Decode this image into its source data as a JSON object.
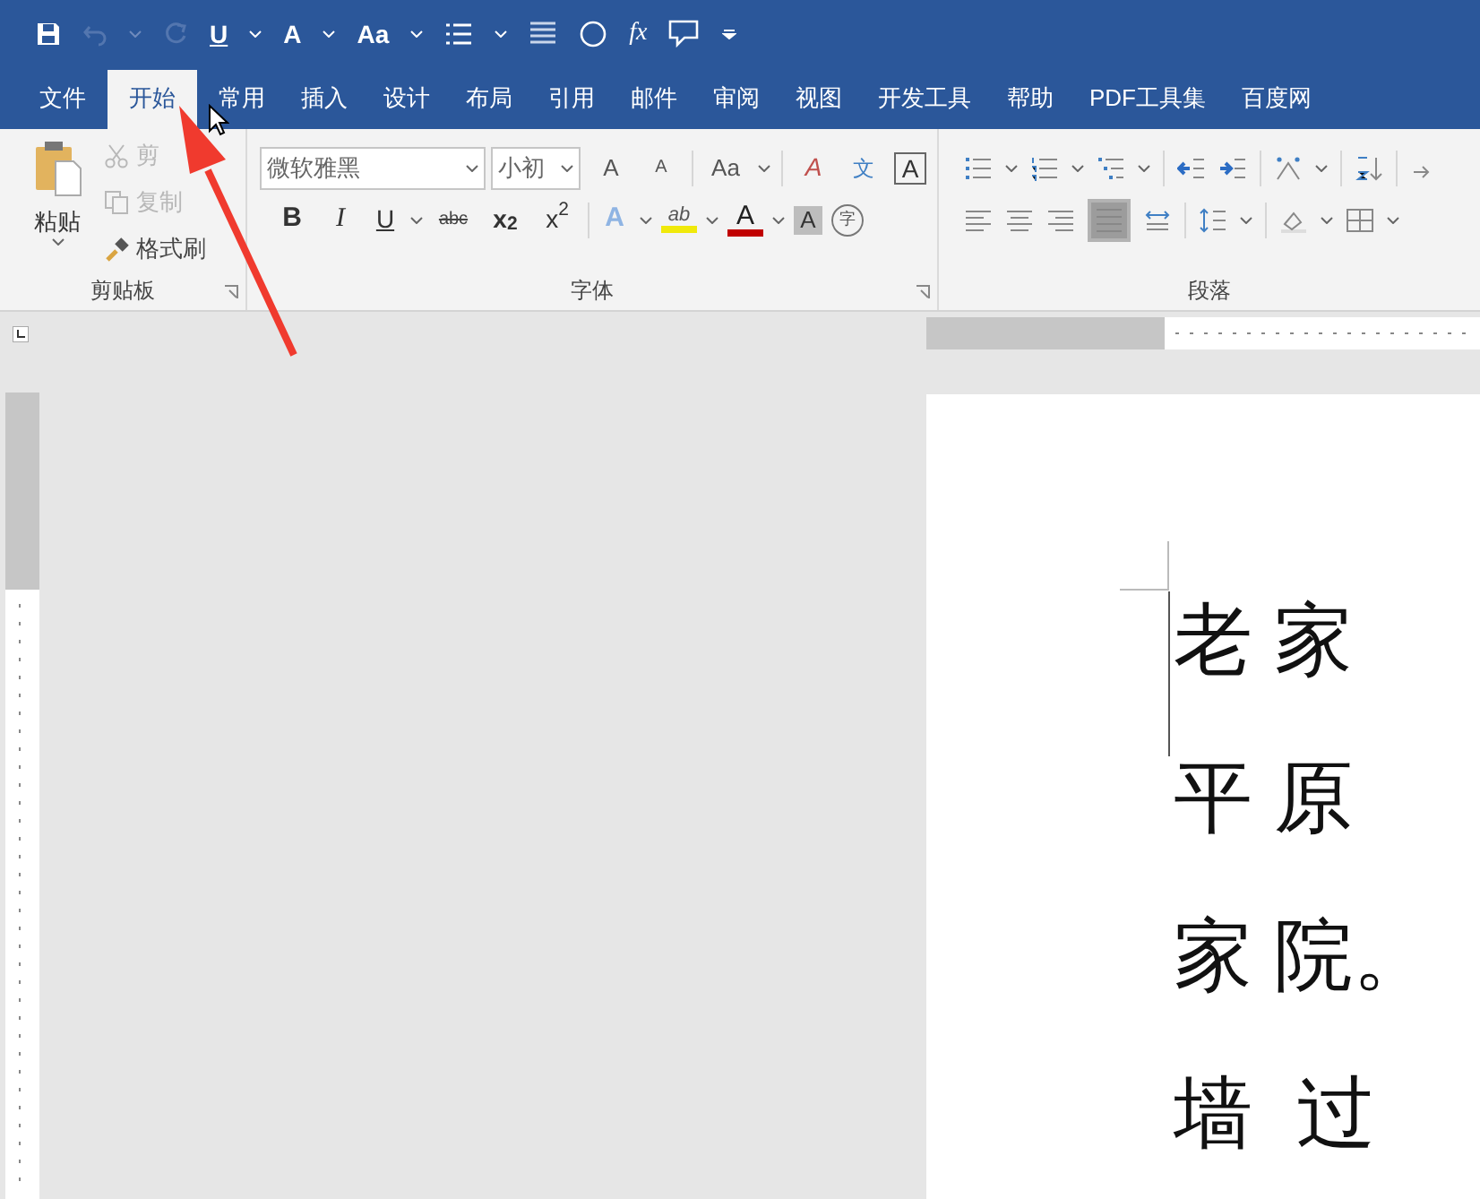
{
  "quick_access": [
    {
      "kind": "save",
      "disabled": false
    },
    {
      "kind": "undo",
      "disabled": true
    },
    {
      "kind": "redo",
      "disabled": true
    },
    {
      "kind": "text",
      "label": "U",
      "disabled": false
    },
    {
      "kind": "text",
      "label": "A",
      "disabled": false
    },
    {
      "kind": "text",
      "label": "Aa",
      "disabled": false
    },
    {
      "kind": "list",
      "disabled": false
    },
    {
      "kind": "align",
      "disabled": false
    },
    {
      "kind": "circle",
      "disabled": false
    },
    {
      "kind": "text",
      "label": "fx",
      "disabled": false
    },
    {
      "kind": "comment",
      "disabled": false
    },
    {
      "kind": "more",
      "disabled": false
    }
  ],
  "tabs": [
    {
      "label": "文件",
      "selected": false
    },
    {
      "label": "开始",
      "selected": true
    },
    {
      "label": "常用",
      "selected": false
    },
    {
      "label": "插入",
      "selected": false
    },
    {
      "label": "设计",
      "selected": false
    },
    {
      "label": "布局",
      "selected": false
    },
    {
      "label": "引用",
      "selected": false
    },
    {
      "label": "邮件",
      "selected": false
    },
    {
      "label": "审阅",
      "selected": false
    },
    {
      "label": "视图",
      "selected": false
    },
    {
      "label": "开发工具",
      "selected": false
    },
    {
      "label": "帮助",
      "selected": false
    },
    {
      "label": "PDF工具集",
      "selected": false
    },
    {
      "label": "百度网",
      "selected": false
    }
  ],
  "clipboard": {
    "label": "剪贴板",
    "paste": "粘贴",
    "items": [
      {
        "kind": "cut",
        "label": "剪",
        "disabled": true
      },
      {
        "kind": "copy",
        "label": "复制",
        "disabled": true
      },
      {
        "kind": "painter",
        "label": "格式刷",
        "disabled": false
      }
    ]
  },
  "font": {
    "label": "字体",
    "font_name": "微软雅黑",
    "font_size": "小初",
    "row_1": [
      {
        "kind": "grow",
        "label": "A"
      },
      {
        "kind": "shrink",
        "label": "A"
      },
      {
        "kind": "case",
        "label": "Aa"
      },
      {
        "kind": "clear",
        "label": "A"
      },
      {
        "kind": "phonetic",
        "label": "文"
      },
      {
        "kind": "border",
        "label": "A"
      }
    ],
    "row_2": [
      {
        "kind": "bold",
        "label": "B"
      },
      {
        "kind": "italic",
        "label": "I"
      },
      {
        "kind": "underline",
        "label": "U"
      },
      {
        "kind": "strike",
        "label": "abc"
      },
      {
        "kind": "sub",
        "label": "x$_{2}$"
      },
      {
        "kind": "super",
        "label": "x$^{2}$"
      },
      {
        "kind": "effect",
        "label": "A"
      },
      {
        "kind": "highlight",
        "label": "ab"
      },
      {
        "kind": "color",
        "label": "A"
      },
      {
        "kind": "shading",
        "label": "A"
      },
      {
        "kind": "enclose",
        "label": "字"
      }
    ]
  },
  "paragraph": {
    "label": "段落"
  },
  "document": {
    "lines": [
      "老 家",
      "平 原",
      "家 院。",
      "墙  过"
    ]
  }
}
